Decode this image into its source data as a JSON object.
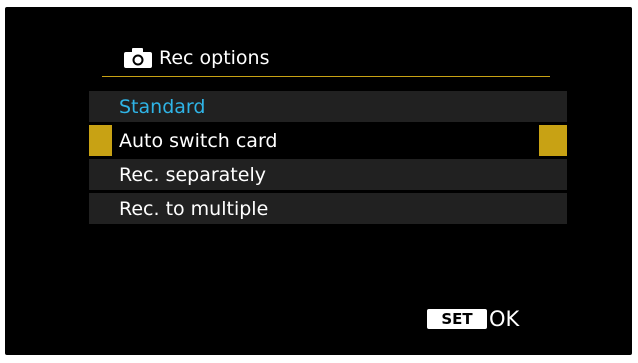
{
  "header": {
    "icon": "camera-icon",
    "title": "Rec options"
  },
  "options": [
    {
      "label": "Standard",
      "state": "current"
    },
    {
      "label": "Auto switch card",
      "state": "selected"
    },
    {
      "label": "Rec. separately",
      "state": "normal"
    },
    {
      "label": "Rec. to multiple",
      "state": "normal"
    }
  ],
  "footer": {
    "set_label": "SET",
    "ok_label": "OK"
  },
  "colors": {
    "background": "#000000",
    "accent_gold": "#c8a214",
    "current_value_blue": "#2fb4e6",
    "row_bg": "#212121"
  }
}
